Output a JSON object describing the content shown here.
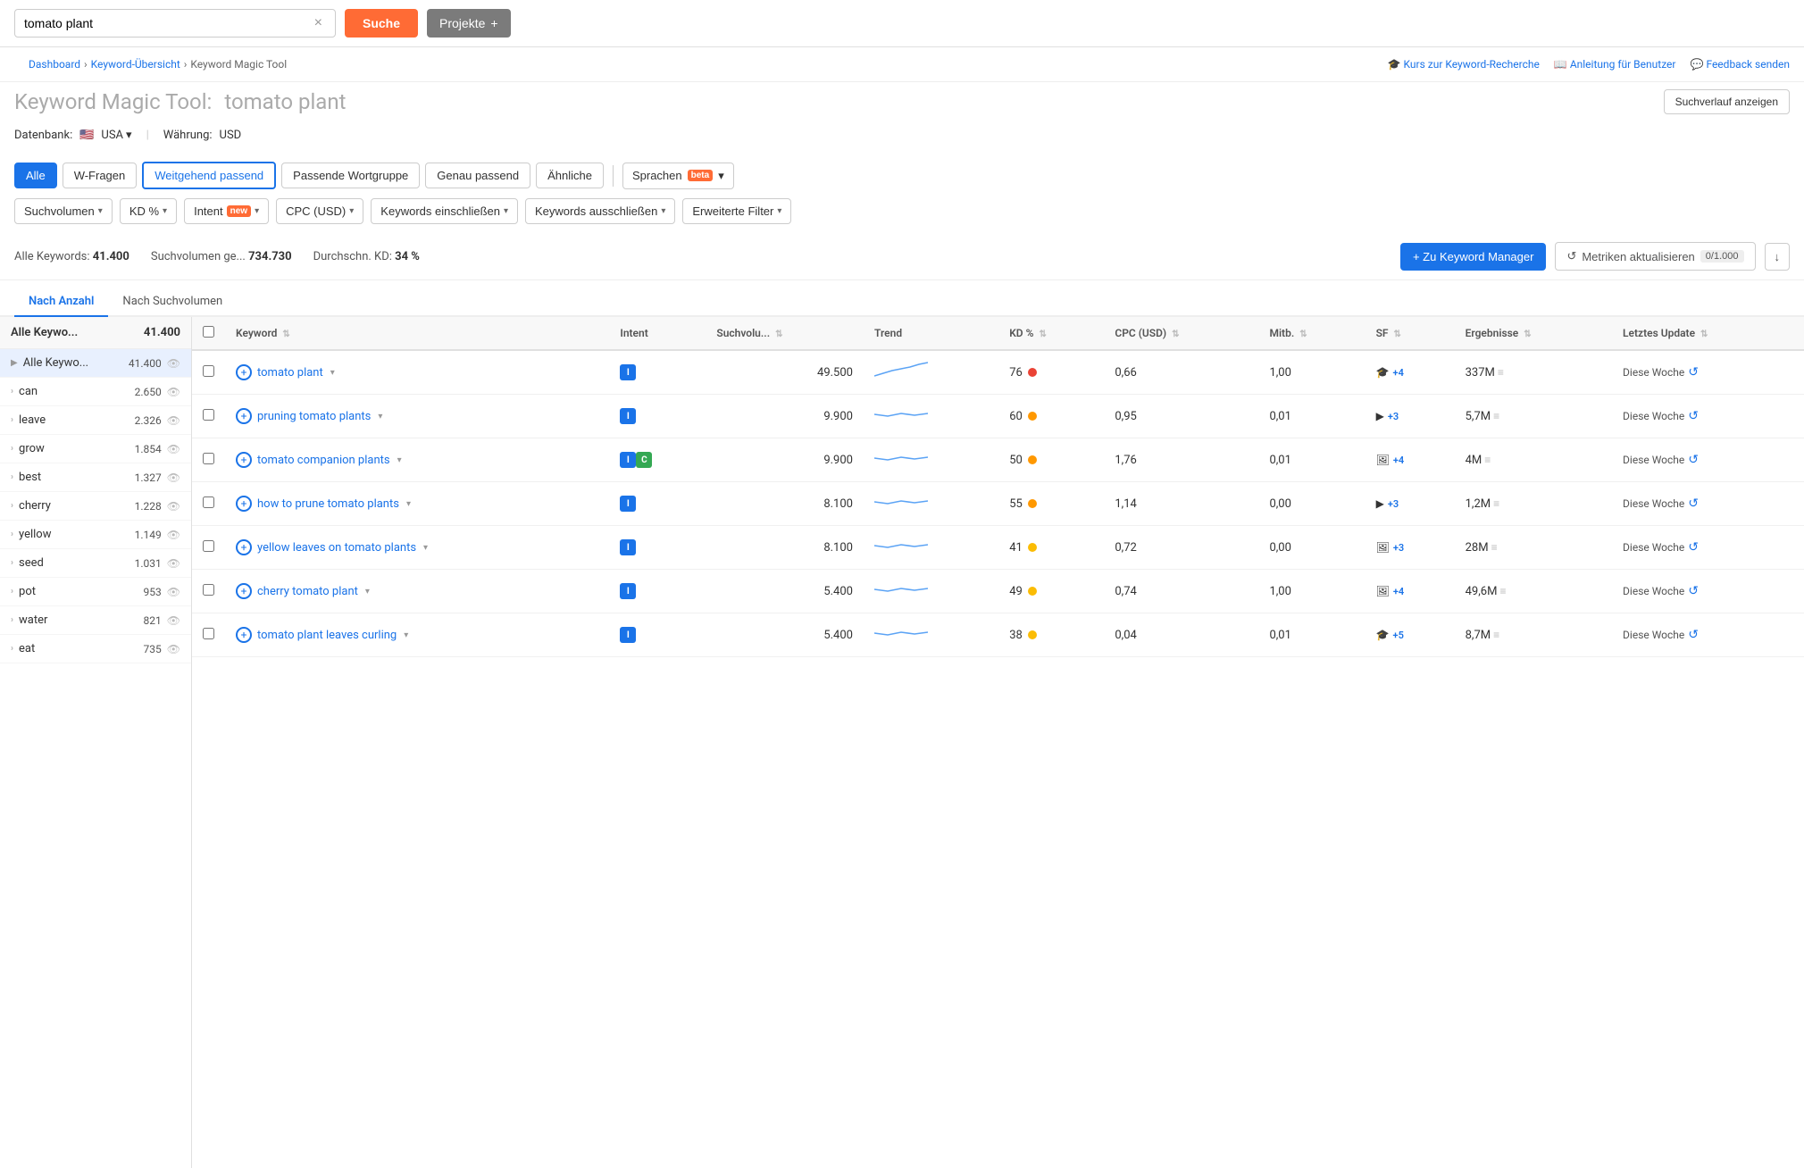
{
  "topbar": {
    "search_value": "tomato plant",
    "search_placeholder": "tomato plant",
    "clear_title": "clear",
    "suche_label": "Suche",
    "projekte_label": "Projekte",
    "projekte_plus": "+"
  },
  "breadcrumb": {
    "items": [
      "Dashboard",
      "Keyword-Übersicht",
      "Keyword Magic Tool"
    ],
    "separator": ">"
  },
  "top_links": [
    {
      "icon": "graduation-icon",
      "label": "Kurs zur Keyword-Recherche"
    },
    {
      "icon": "book-icon",
      "label": "Anleitung für Benutzer"
    },
    {
      "icon": "chat-icon",
      "label": "Feedback senden"
    }
  ],
  "page_header": {
    "title_prefix": "Keyword Magic Tool:",
    "title_query": "tomato plant",
    "history_btn": "Suchverlauf anzeigen"
  },
  "db_row": {
    "label": "Datenbank:",
    "flag": "🇺🇸",
    "country": "USA",
    "separator": "|",
    "currency_label": "Währung:",
    "currency": "USD"
  },
  "filter_tabs": {
    "tabs": [
      "Alle",
      "W-Fragen",
      "Weitgehend passend",
      "Passende Wortgruppe",
      "Genau passend",
      "Ähnliche"
    ],
    "active": "Alle",
    "outlined": "Weitgehend passend",
    "sprachen_label": "Sprachen",
    "beta_label": "beta"
  },
  "filter_row": {
    "filters": [
      {
        "label": "Suchvolumen",
        "has_chevron": true
      },
      {
        "label": "KD %",
        "has_chevron": true
      },
      {
        "label": "Intent",
        "has_badge": "new",
        "has_chevron": true
      },
      {
        "label": "CPC (USD)",
        "has_chevron": true
      },
      {
        "label": "Keywords einschließen",
        "has_chevron": true
      },
      {
        "label": "Keywords ausschließen",
        "has_chevron": true
      },
      {
        "label": "Erweiterte Filter",
        "has_chevron": true
      }
    ]
  },
  "stats_bar": {
    "all_keywords_label": "Alle Keywords:",
    "all_keywords_value": "41.400",
    "volume_label": "Suchvolumen ge...",
    "volume_value": "734.730",
    "avg_kd_label": "Durchschn. KD:",
    "avg_kd_value": "34 %",
    "add_btn": "+ Zu Keyword Manager",
    "update_btn": "Metriken aktualisieren",
    "update_count": "0/1.000",
    "export_icon": "↓"
  },
  "sort_tabs": [
    "Nach Anzahl",
    "Nach Suchvolumen"
  ],
  "sort_active": "Nach Anzahl",
  "sidebar": {
    "header_label": "Alle Keywo...",
    "header_count": "41.400",
    "items": [
      {
        "label": "can",
        "count": "2.650"
      },
      {
        "label": "leave",
        "count": "2.326"
      },
      {
        "label": "grow",
        "count": "1.854"
      },
      {
        "label": "best",
        "count": "1.327"
      },
      {
        "label": "cherry",
        "count": "1.228"
      },
      {
        "label": "yellow",
        "count": "1.149"
      },
      {
        "label": "seed",
        "count": "1.031"
      },
      {
        "label": "pot",
        "count": "953"
      },
      {
        "label": "water",
        "count": "821"
      },
      {
        "label": "eat",
        "count": "735"
      }
    ]
  },
  "table": {
    "columns": [
      "",
      "Keyword",
      "Intent",
      "Suchvolu...",
      "Trend",
      "KD %",
      "CPC (USD)",
      "Mitb.",
      "SF",
      "Ergebnisse",
      "Letztes Update"
    ],
    "rows": [
      {
        "keyword": "tomato plant",
        "intent": [
          "i"
        ],
        "volume": "49.500",
        "kd": "76",
        "kd_color": "red",
        "cpc": "0,66",
        "mitb": "1,00",
        "sf_icon": "graduation",
        "sf_plus": "+4",
        "results": "337M",
        "update": "Diese Woche"
      },
      {
        "keyword": "pruning tomato plants",
        "intent": [
          "i"
        ],
        "volume": "9.900",
        "kd": "60",
        "kd_color": "orange",
        "cpc": "0,95",
        "mitb": "0,01",
        "sf_icon": "video",
        "sf_plus": "+3",
        "results": "5,7M",
        "update": "Diese Woche"
      },
      {
        "keyword": "tomato companion plants",
        "intent": [
          "i",
          "c"
        ],
        "volume": "9.900",
        "kd": "50",
        "kd_color": "orange",
        "cpc": "1,76",
        "mitb": "0,01",
        "sf_icon": "image",
        "sf_plus": "+4",
        "results": "4M",
        "update": "Diese Woche"
      },
      {
        "keyword": "how to prune tomato plants",
        "intent": [
          "i"
        ],
        "volume": "8.100",
        "kd": "55",
        "kd_color": "orange",
        "cpc": "1,14",
        "mitb": "0,00",
        "sf_icon": "video",
        "sf_plus": "+3",
        "results": "1,2M",
        "update": "Diese Woche"
      },
      {
        "keyword": "yellow leaves on tomato plants",
        "intent": [
          "i"
        ],
        "volume": "8.100",
        "kd": "41",
        "kd_color": "yellow",
        "cpc": "0,72",
        "mitb": "0,00",
        "sf_icon": "image",
        "sf_plus": "+3",
        "results": "28M",
        "update": "Diese Woche"
      },
      {
        "keyword": "cherry tomato plant",
        "intent": [
          "i"
        ],
        "volume": "5.400",
        "kd": "49",
        "kd_color": "yellow",
        "cpc": "0,74",
        "mitb": "1,00",
        "sf_icon": "image",
        "sf_plus": "+4",
        "results": "49,6M",
        "update": "Diese Woche"
      },
      {
        "keyword": "tomato plant leaves curling",
        "intent": [
          "i"
        ],
        "volume": "5.400",
        "kd": "38",
        "kd_color": "yellow",
        "cpc": "0,04",
        "mitb": "0,01",
        "sf_icon": "graduation",
        "sf_plus": "+5",
        "results": "8,7M",
        "update": "Diese Woche"
      }
    ]
  },
  "intent_new_label": "Intent new"
}
